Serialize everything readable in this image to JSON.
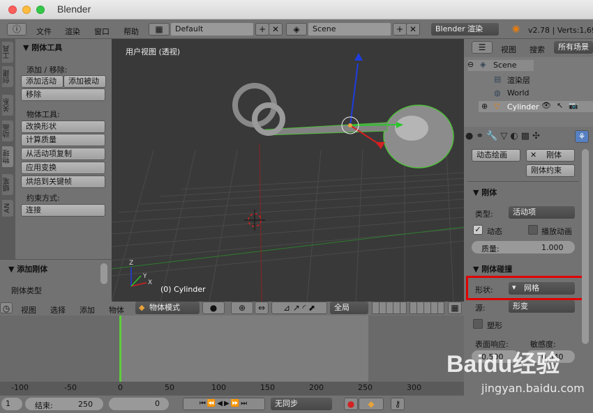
{
  "window": {
    "title": "Blender"
  },
  "header": {
    "menus": [
      "文件",
      "渲染",
      "窗口",
      "帮助"
    ],
    "layout": "Default",
    "scene": "Scene",
    "engine": "Blender 渲染",
    "version": "v2.78 | Verts:1,69"
  },
  "tool_tabs": [
    "工具",
    "创建",
    "关系",
    "动画",
    "物理",
    "蜡笔",
    "AN"
  ],
  "tool_panel": {
    "title": "刚体工具",
    "add_remove": "添加 / 移除:",
    "add_active": "添加活动",
    "add_passive": "添加被动",
    "remove": "移除",
    "object_tools": "物体工具:",
    "buttons": [
      "改换形状",
      "计算质量",
      "从活动项复制",
      "应用变换",
      "烘焙到关键帧"
    ],
    "constraint": "约束方式:",
    "connect": "连接",
    "add_rigid": "添加刚体",
    "rigid_type": "刚体类型"
  },
  "viewport": {
    "title": "用户视图 (透视)",
    "object": "(0) Cylinder",
    "axes": {
      "z": "Z",
      "y": "Y",
      "x": "X"
    }
  },
  "outliner": {
    "view": "视图",
    "search": "搜索",
    "all_scenes": "所有场景",
    "items": [
      "Scene",
      "渲染层",
      "World",
      "Cylinder"
    ]
  },
  "properties": {
    "dynamic_paint": "动态绘画",
    "rigid_body": "刚体",
    "rigid_constraint": "刚体约束",
    "rb_header": "刚体",
    "type_label": "类型:",
    "type_value": "活动项",
    "dynamic": "动态",
    "animated": "播放动画",
    "mass_label": "质量:",
    "mass_value": "1.000",
    "collision_header": "刚体碰撞",
    "shape_label": "形状:",
    "shape_value": "网格",
    "source_label": "源:",
    "source_value": "形变",
    "deform": "塑形",
    "surface_label": "表面响应:",
    "sensitivity_label": "敏感度:",
    "friction_value": "0.500",
    "margin_value": "0.040"
  },
  "timeline_header": {
    "menus": [
      "视图",
      "选择",
      "添加",
      "物体"
    ],
    "mode": "物体模式",
    "pivot": "全局"
  },
  "ruler": [
    "-100",
    "-50",
    "0",
    "50",
    "100",
    "150",
    "200",
    "250",
    "300"
  ],
  "footer": {
    "start": "1",
    "end_label": "结束:",
    "end": "250",
    "current": "0",
    "sync": "无同步"
  },
  "watermark": {
    "text": "Baidu经验",
    "sub": "jingyan.baidu.com"
  },
  "colors": {
    "highlight": "#e00000",
    "accent": "#5680c2"
  }
}
